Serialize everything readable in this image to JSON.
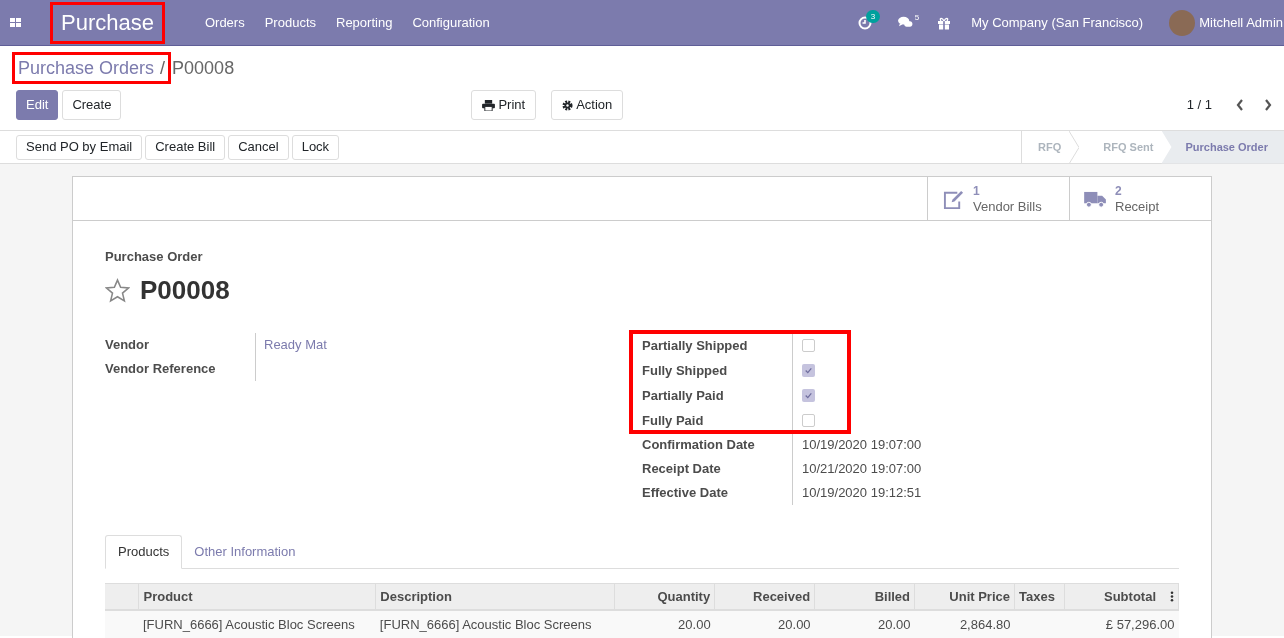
{
  "navbar": {
    "app_title": "Purchase",
    "app_title_highlighted": true,
    "menu": [
      "Orders",
      "Products",
      "Reporting",
      "Configuration"
    ],
    "activity_count": "3",
    "message_count": "5",
    "company": "My Company (San Francisco)",
    "user": "Mitchell Admin"
  },
  "breadcrumb": {
    "parent": "Purchase Orders",
    "separator": "/",
    "parent_highlighted": true,
    "current": "P00008"
  },
  "control_buttons": [
    {
      "label": "Edit",
      "kind": "primary"
    },
    {
      "label": "Create",
      "kind": "secondary"
    }
  ],
  "action_buttons": [
    {
      "label": "Print",
      "kind": "print"
    },
    {
      "label": "Action",
      "kind": "gear"
    }
  ],
  "pager": "1 / 1",
  "header_buttons": [
    "Send PO by Email",
    "Create Bill",
    "Cancel",
    "Lock"
  ],
  "stages": [
    {
      "label": "RFQ",
      "selected": false
    },
    {
      "label": "RFQ Sent",
      "selected": false
    },
    {
      "label": "Purchase Order",
      "selected": true
    }
  ],
  "smart_buttons": [
    {
      "kind": "bills",
      "count": "1",
      "label": "Vendor Bills"
    },
    {
      "kind": "receipt",
      "count": "2",
      "label": "Receipt"
    }
  ],
  "document_type": "Purchase Order",
  "document_name": "P00008",
  "starred": false,
  "left_fields": [
    {
      "label": "Vendor",
      "value": "Ready Mat",
      "kind": "link"
    },
    {
      "label": "Vendor Reference",
      "kind": "text"
    }
  ],
  "flags_highlighted": true,
  "flags": [
    {
      "label": "Partially Shipped",
      "checked": false
    },
    {
      "label": "Fully Shipped",
      "checked": true
    },
    {
      "label": "Partially Paid",
      "checked": true
    },
    {
      "label": "Fully Paid",
      "checked": false
    }
  ],
  "dates": [
    {
      "label": "Confirmation Date",
      "value": "10/19/2020 19:07:00"
    },
    {
      "label": "Receipt Date",
      "value": "10/21/2020 19:07:00"
    },
    {
      "label": "Effective Date",
      "value": "10/19/2020 19:12:51"
    }
  ],
  "tabs": [
    {
      "label": "Products",
      "selected": true
    },
    {
      "label": "Other Information",
      "selected": false
    }
  ],
  "table": {
    "columns": [
      {
        "label": "Product",
        "kind": "text"
      },
      {
        "label": "Description",
        "kind": "text"
      },
      {
        "label": "Quantity",
        "kind": "number"
      },
      {
        "label": "Received",
        "kind": "number"
      },
      {
        "label": "Billed",
        "kind": "number"
      },
      {
        "label": "Unit Price",
        "kind": "number"
      },
      {
        "label": "Taxes",
        "kind": "text"
      },
      {
        "label": "Subtotal",
        "kind": "number"
      }
    ],
    "rows": [
      [
        "[FURN_6666] Acoustic Bloc Screens",
        "[FURN_6666] Acoustic Bloc Screens",
        "20.00",
        "20.00",
        "20.00",
        "2,864.80",
        "",
        "£ 57,296.00"
      ]
    ]
  }
}
